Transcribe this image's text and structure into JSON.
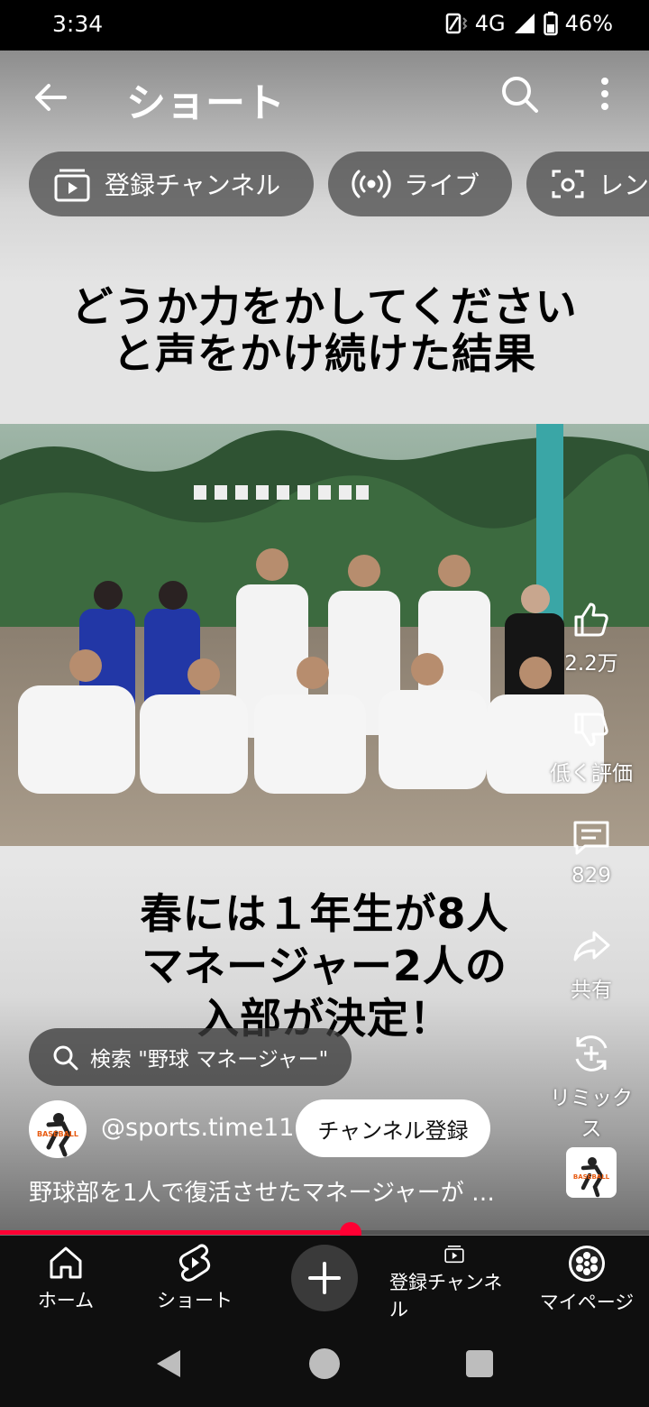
{
  "status_bar": {
    "time": "3:34",
    "network": "4G",
    "battery": "46%"
  },
  "header": {
    "title": "ショート",
    "back_icon": "arrow-left-icon",
    "search_icon": "search-icon",
    "more_icon": "more-vert-icon"
  },
  "chips": [
    {
      "label": "登録チャンネル",
      "icon": "subscriptions-icon"
    },
    {
      "label": "ライブ",
      "icon": "live-icon"
    },
    {
      "label": "レン",
      "icon": "camera-icon"
    }
  ],
  "video": {
    "top_caption_line1": "どうか力をかしてください",
    "top_caption_line2": "と声をかけ続けた結果",
    "bottom_caption_line1": "春には１年生が8人",
    "bottom_caption_line2": "マネージャー2人の",
    "bottom_caption_line3": "入部が決定！"
  },
  "actions": {
    "like_count": "2.2万",
    "dislike_label": "低く評価",
    "comment_count": "829",
    "share_label": "共有",
    "remix_label": "リミックス"
  },
  "search_suggestion": "検索 \"野球 マネージャー\"",
  "channel": {
    "handle": "@sports.time11",
    "subscribe_label": "チャンネル登録",
    "logo_text": "BASEBALL"
  },
  "description": "野球部を1人で復活させたマネージャーが …",
  "progress_fraction": 0.54,
  "bottom_nav": {
    "home": "ホーム",
    "shorts": "ショート",
    "subscriptions": "登録チャンネル",
    "mypage": "マイページ"
  },
  "colors": {
    "accent": "#ff0033",
    "nav_bg": "#0f0f0f"
  }
}
